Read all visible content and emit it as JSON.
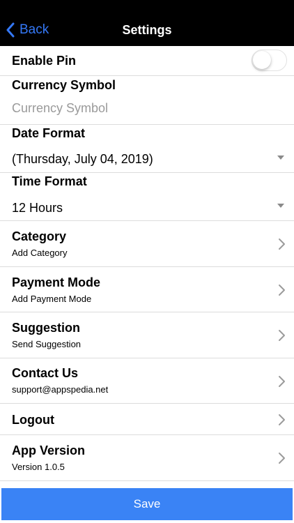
{
  "nav": {
    "back_label": "Back",
    "title": "Settings"
  },
  "enable_pin": {
    "label": "Enable Pin",
    "enabled": false
  },
  "currency": {
    "label": "Currency Symbol",
    "placeholder": "Currency Symbol",
    "value": ""
  },
  "date_format": {
    "label": "Date Format",
    "selected": "(Thursday, July 04, 2019)"
  },
  "time_format": {
    "label": "Time Format",
    "selected": "12 Hours"
  },
  "menu": [
    {
      "title": "Category",
      "subtitle": "Add Category"
    },
    {
      "title": "Payment Mode",
      "subtitle": "Add Payment Mode"
    },
    {
      "title": "Suggestion",
      "subtitle": "Send Suggestion"
    },
    {
      "title": "Contact Us",
      "subtitle": "support@appspedia.net"
    },
    {
      "title": "Logout",
      "subtitle": ""
    },
    {
      "title": "App Version",
      "subtitle": "Version 1.0.5"
    }
  ],
  "save_label": "Save",
  "colors": {
    "accent": "#3a83f5",
    "navbar": "#000000",
    "divider": "#dcdcdc"
  }
}
